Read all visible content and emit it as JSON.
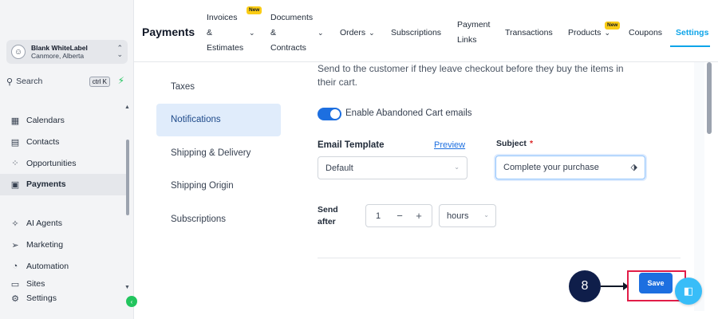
{
  "account": {
    "name": "Blank WhiteLabel",
    "location": "Canmore, Alberta"
  },
  "search": {
    "label": "Search",
    "shortcut": "ctrl K"
  },
  "sidebar": {
    "items": [
      {
        "label": "Calendars",
        "icon": "calendar-icon"
      },
      {
        "label": "Contacts",
        "icon": "contacts-icon"
      },
      {
        "label": "Opportunities",
        "icon": "opportunities-icon"
      },
      {
        "label": "Payments",
        "icon": "payments-icon",
        "active": true
      }
    ],
    "items2": [
      {
        "label": "AI Agents",
        "icon": "sparkle-icon"
      },
      {
        "label": "Marketing",
        "icon": "send-icon"
      },
      {
        "label": "Automation",
        "icon": "automation-icon"
      },
      {
        "label": "Sites",
        "icon": "sites-icon"
      },
      {
        "label": "Settings",
        "icon": "gear-icon"
      }
    ]
  },
  "topbar": {
    "title": "Payments",
    "tabs": {
      "invoices_1": "Invoices",
      "invoices_2": "&",
      "invoices_3": "Estimates",
      "documents_1": "Documents",
      "documents_2": "&",
      "documents_3": "Contracts",
      "orders": "Orders",
      "subscriptions": "Subscriptions",
      "payment_links_1": "Payment",
      "payment_links_2": "Links",
      "transactions": "Transactions",
      "products": "Products",
      "coupons": "Coupons",
      "settings": "Settings"
    },
    "new_badge": "New"
  },
  "subnav": [
    "Taxes",
    "Notifications",
    "Shipping & Delivery",
    "Shipping Origin",
    "Subscriptions"
  ],
  "content": {
    "description_1": "Send to the customer if they leave checkout before they buy the items in",
    "description_2": "their cart.",
    "toggle_label": "Enable Abandoned Cart emails",
    "email_template_label": "Email Template",
    "preview_link": "Preview",
    "email_template_value": "Default",
    "subject_label": "Subject",
    "subject_required": "*",
    "subject_value": "Complete your purchase",
    "send_after_1": "Send",
    "send_after_2": "after",
    "send_after_value": "1",
    "minus": "−",
    "plus": "+",
    "send_after_unit": "hours"
  },
  "actions": {
    "save_label": "Save"
  },
  "annotation": {
    "step_number": "8"
  },
  "colors": {
    "accent": "#1d6fe0",
    "settings_tab": "#0ea5e9",
    "annotation_box": "#e11d48",
    "step_circle": "#0f1e4a",
    "new_badge": "#facc15"
  }
}
